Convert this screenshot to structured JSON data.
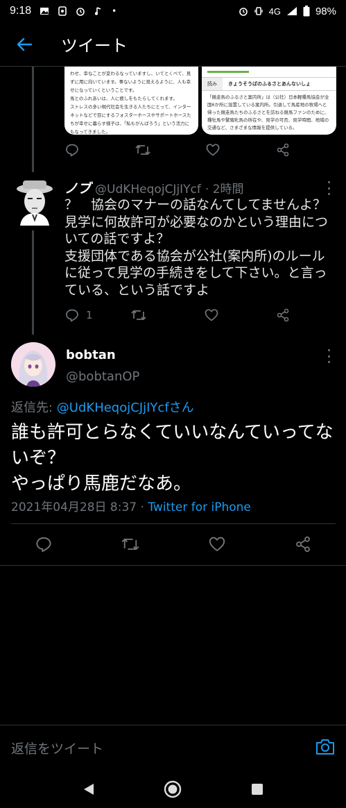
{
  "status_bar": {
    "time": "9:18",
    "dot": "•",
    "network": "4G",
    "battery": "98%"
  },
  "header": {
    "title": "ツイート"
  },
  "quoted_images": {
    "left_text": "わせ、幸なことが変わるなっていますし、いてとくべて、見ずに用に向いています。事ないように見えるように、人も幸せになっていくということです。\n馬とのふれあいは、人に癒しをもたらしてくれます。\nストレスの多い現代社会を生きる人たちにとって、インターネットなどで目にするフォスターホースやサポートホースたちが幸せに暮らす様子は、「私もがんばろう」という活力にもなってきました。\n行き場のない馬を助けたという満足感は、実はひとつの側面に過ぎません。",
    "right_label": "読み",
    "right_title": "きょうそうばのふるさとあんないしょ",
    "right_text": "「競走馬のふるさと案内所」は（公社）日本軽種馬協会が全国6か所に設置している案内所。引退して馬産地の牧場へと帰った競走馬たちのふるさとを訪ねる競馬ファンのために、種牡馬や繁殖牝馬の所在や、見学の可否、見学時間、地域の交通など、さまざまな情報を提供している。"
  },
  "reply_tweet": {
    "name": "ノブ",
    "handle": "@UdKHeqojCJjIYcf",
    "time": "· 2時間",
    "body": "？　協会のマナーの話なんてしてませんよ？\n見学に何故許可が必要なのかという理由についての話ですよ？\n支援団体である協会が公社(案内所)のルールに従って見学の手続きをして下さい。と言っている、という話ですよ",
    "reply_count": "1"
  },
  "main_tweet": {
    "name": "bobtan",
    "handle": "@bobtanOP",
    "replying_prefix": "返信先: ",
    "replying_to": "@UdKHeqojCJjIYcfさん",
    "text": "誰も許可とらなくていいなんていってないぞ？\nやっぱり馬鹿だなあ。",
    "timestamp": "2021年04月28日 8:37 · ",
    "source": "Twitter for iPhone"
  },
  "reply_bar": {
    "placeholder": "返信をツイート"
  },
  "colors": {
    "accent": "#1d9bf0",
    "muted": "#71767b",
    "background": "#000000"
  },
  "icons": [
    "back-arrow-icon",
    "reply-icon",
    "retweet-icon",
    "like-icon",
    "share-icon",
    "more-icon",
    "camera-icon",
    "nav-back-icon",
    "nav-home-icon",
    "nav-recents-icon"
  ]
}
